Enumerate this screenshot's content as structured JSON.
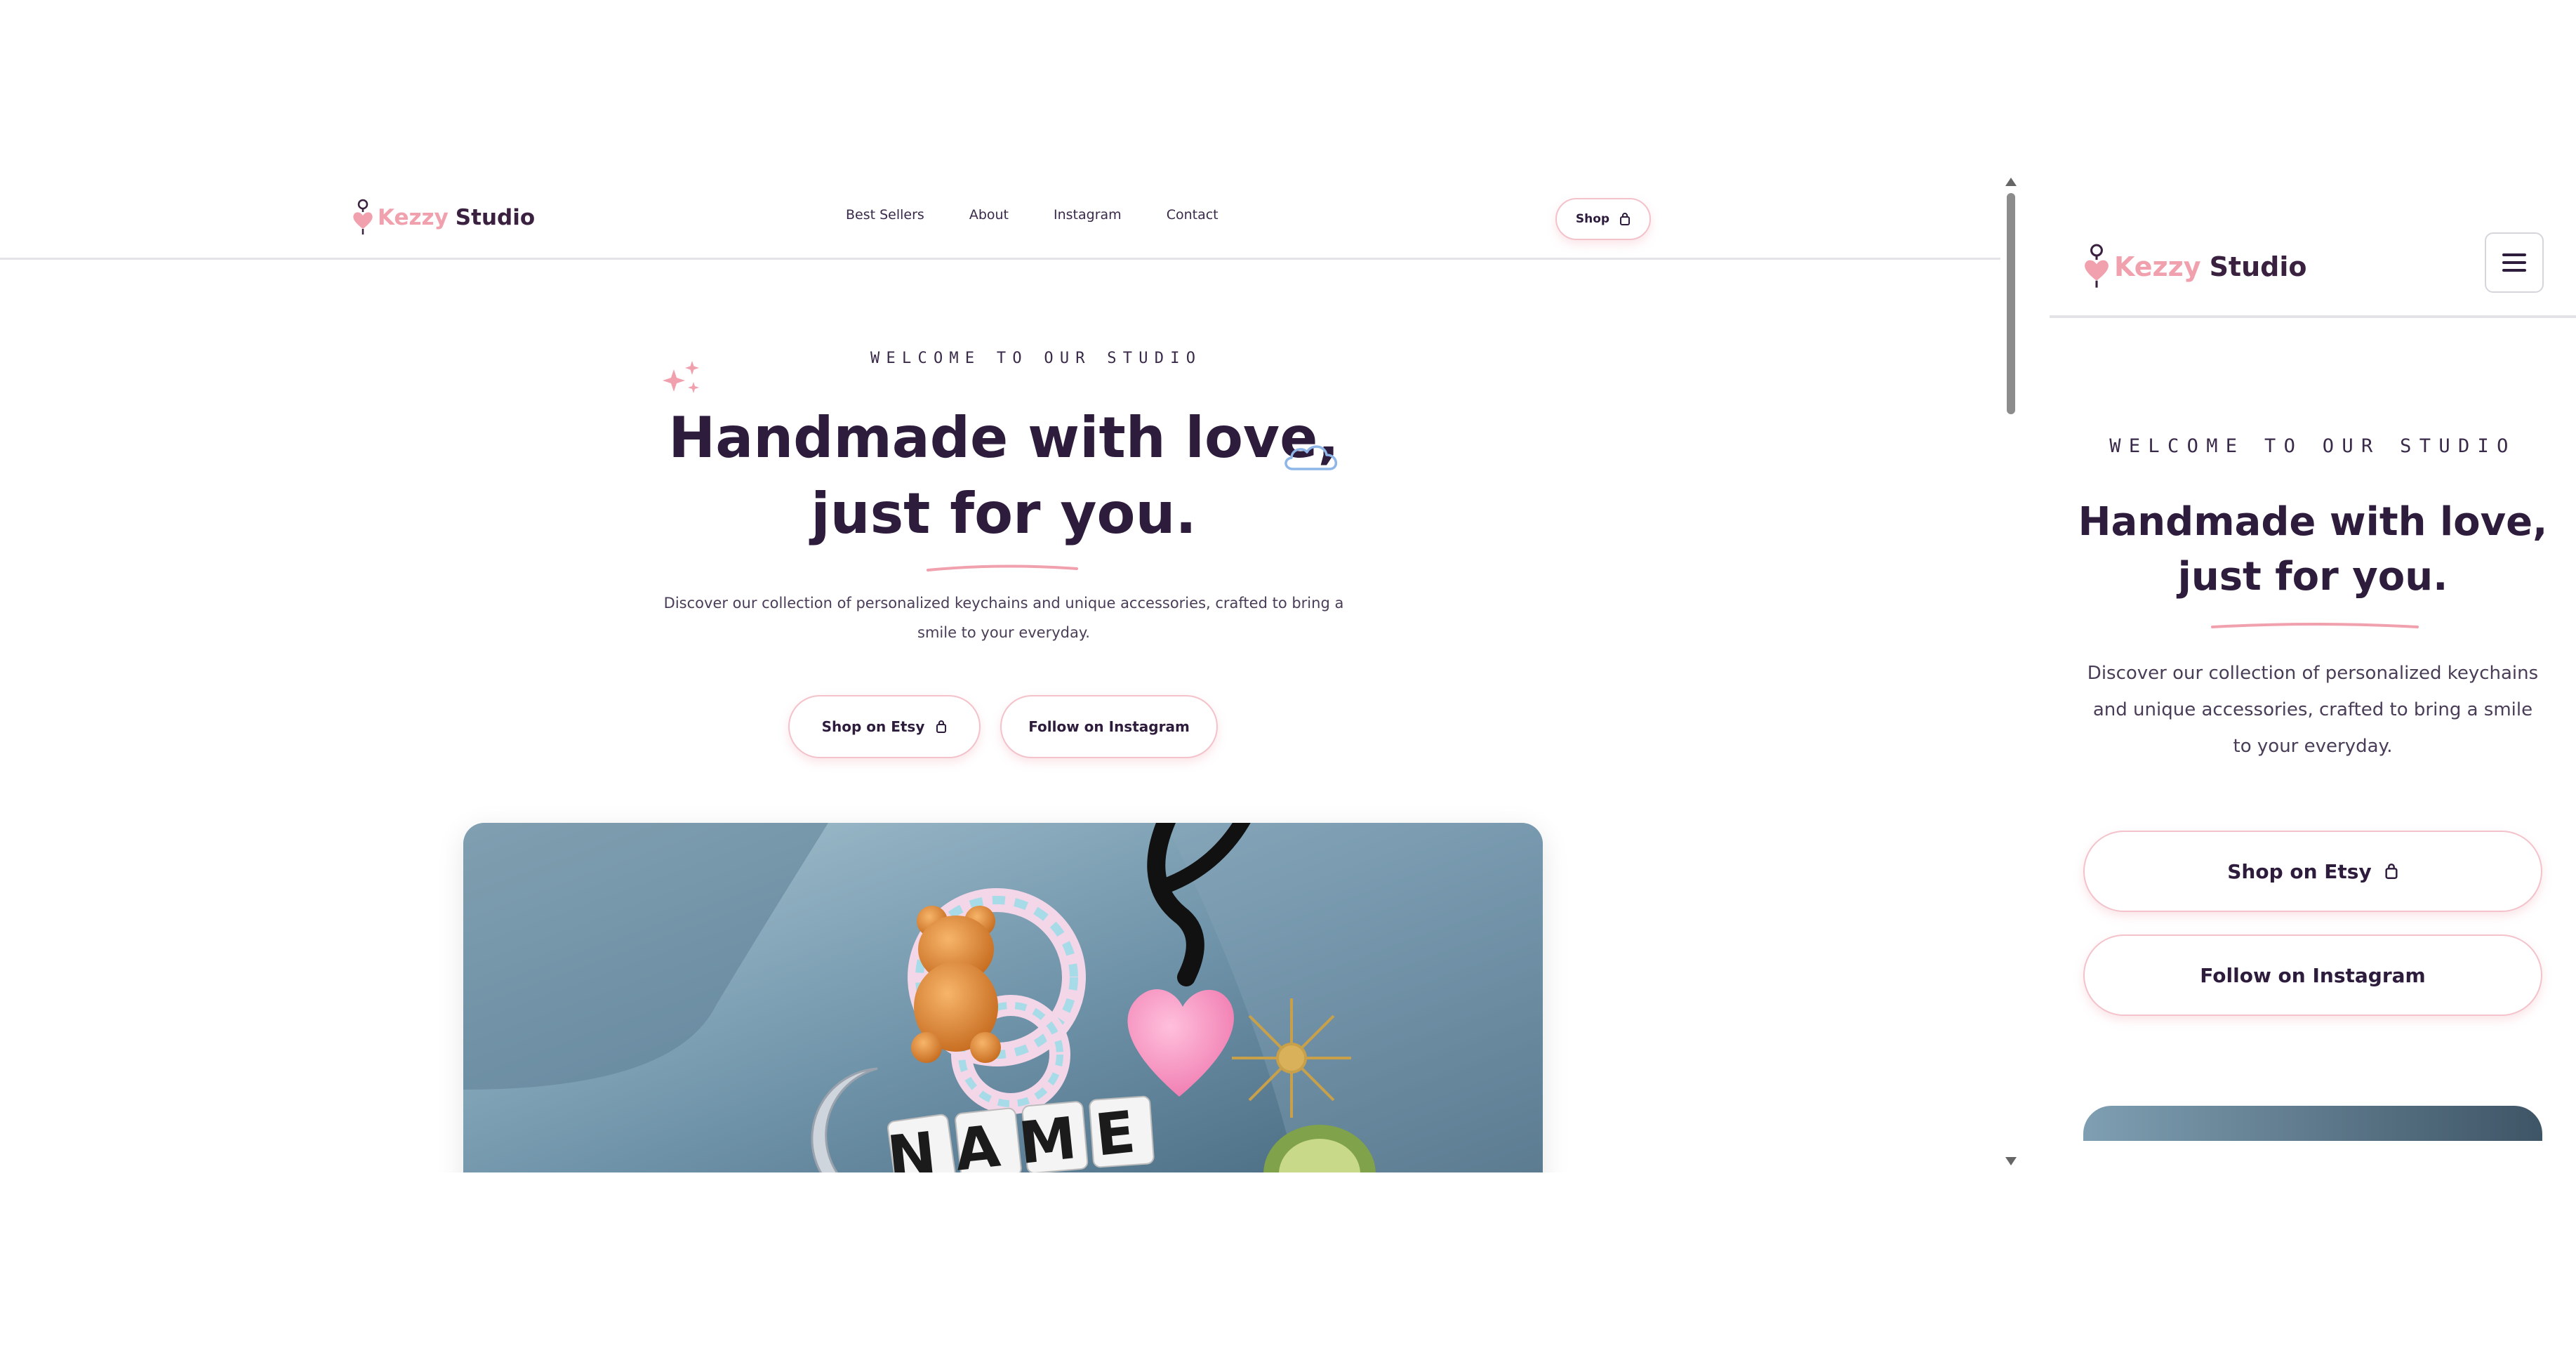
{
  "brand": {
    "name_part1": "Kezzy",
    "name_part2": "Studio",
    "colors": {
      "pink": "#f0a1ad",
      "plum": "#3b2140",
      "border_pink": "#f3c2cb",
      "cloud_blue": "#8fb6e8"
    }
  },
  "nav": {
    "items": [
      "Best Sellers",
      "About",
      "Instagram",
      "Contact"
    ],
    "shop_label": "Shop"
  },
  "hero": {
    "eyebrow": "WELCOME TO OUR STUDIO",
    "title_line1": "Handmade with love,",
    "title_line2": "just for you.",
    "description": "Discover our collection of personalized keychains and unique accessories, crafted to bring a smile to your everyday.",
    "btn_shop": "Shop on Etsy",
    "btn_instagram": "Follow on Instagram",
    "photo_text": "NAME"
  },
  "icons": {
    "logo": "keychain-heart-icon",
    "bag": "shopping-bag-icon",
    "sparkle": "sparkle-icon",
    "cloud": "cloud-icon",
    "menu": "hamburger-menu-icon"
  }
}
